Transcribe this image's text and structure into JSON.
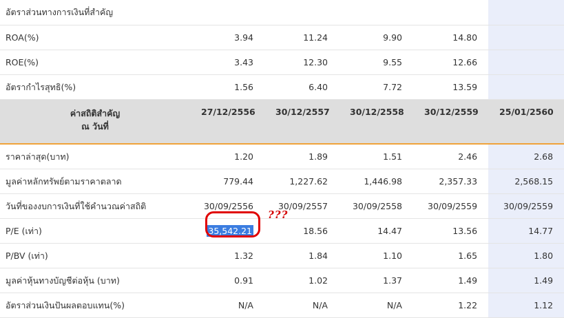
{
  "section_title": "อัตราส่วนทางการเงินที่สำคัญ",
  "ratios": [
    {
      "label": "ROA(%)",
      "values": [
        "3.94",
        "11.24",
        "9.90",
        "14.80",
        ""
      ]
    },
    {
      "label": "ROE(%)",
      "values": [
        "3.43",
        "12.30",
        "9.55",
        "12.66",
        ""
      ]
    },
    {
      "label": "อัตรากำไรสุทธิ(%)",
      "values": [
        "1.56",
        "6.40",
        "7.72",
        "13.59",
        ""
      ]
    }
  ],
  "stats_header": {
    "label_line1": "ค่าสถิติสำคัญ",
    "label_line2": "ณ วันที่",
    "dates": [
      "27/12/2556",
      "30/12/2557",
      "30/12/2558",
      "30/12/2559",
      "25/01/2560"
    ]
  },
  "stats": [
    {
      "label": "ราคาล่าสุด(บาท)",
      "values": [
        "1.20",
        "1.89",
        "1.51",
        "2.46",
        "2.68"
      ]
    },
    {
      "label": "มูลค่าหลักทรัพย์ตามราคาตลาด",
      "values": [
        "779.44",
        "1,227.62",
        "1,446.98",
        "2,357.33",
        "2,568.15"
      ]
    },
    {
      "label": "วันที่ของงบการเงินที่ใช้คำนวณค่าสถิติ",
      "values": [
        "30/09/2556",
        "30/09/2557",
        "30/09/2558",
        "30/09/2559",
        "30/09/2559"
      ]
    },
    {
      "label": "P/E (เท่า)",
      "values": [
        "35,542.21",
        "18.56",
        "14.47",
        "13.56",
        "14.77"
      ]
    },
    {
      "label": "P/BV (เท่า)",
      "values": [
        "1.32",
        "1.84",
        "1.10",
        "1.65",
        "1.80"
      ]
    },
    {
      "label": "มูลค่าหุ้นทางบัญชีต่อหุ้น (บาท)",
      "values": [
        "0.91",
        "1.02",
        "1.37",
        "1.49",
        "1.49"
      ]
    },
    {
      "label": "อัตราส่วนเงินปันผลตอบแทน(%)",
      "values": [
        "N/A",
        "N/A",
        "N/A",
        "1.22",
        "1.12"
      ]
    }
  ],
  "annotation": {
    "text": "???",
    "color": "#d40000",
    "circle_color": "#e00000"
  },
  "colors": {
    "header_bg": "#dedede",
    "header_border": "#f0a23a",
    "highlight_col": "#eaeefa",
    "selection": "#3b7de0"
  }
}
